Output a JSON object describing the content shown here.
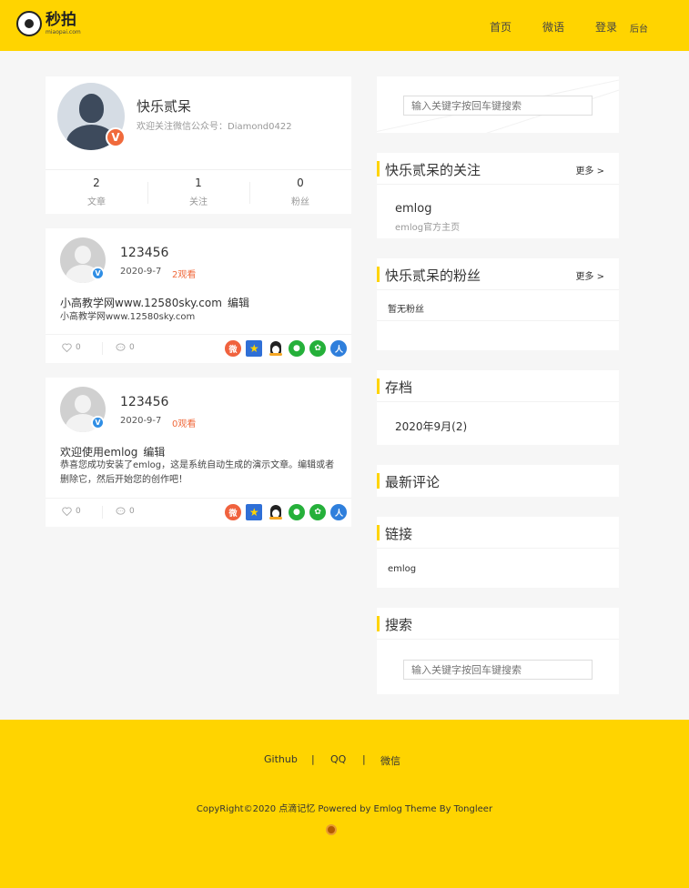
{
  "header": {
    "logo_cn": "秒拍",
    "logo_en": "miaopai.com",
    "nav": {
      "home": "首页",
      "weiyu": "微语",
      "login": "登录",
      "admin": "后台"
    },
    "color": "#ffd400"
  },
  "profile": {
    "name": "快乐贰呆",
    "desc": "欢迎关注微信公众号：Diamond0422",
    "badge": "V",
    "stats": [
      {
        "num": "2",
        "label": "文章"
      },
      {
        "num": "1",
        "label": "关注"
      },
      {
        "num": "0",
        "label": "粉丝"
      }
    ]
  },
  "posts": [
    {
      "title": "123456",
      "date": "2020-9-7",
      "views": "2观看",
      "headline": "小高教学网www.12580sky.com",
      "edit": "编辑",
      "excerpt": "小高教学网www.12580sky.com",
      "likes": "0",
      "comments": "0",
      "badge": "V"
    },
    {
      "title": "123456",
      "date": "2020-9-7",
      "views": "0观看",
      "headline": "欢迎使用emlog",
      "edit": "编辑",
      "excerpt": "恭喜您成功安装了emlog，这是系统自动生成的演示文章。编辑或者删除它，然后开始您的创作吧！",
      "likes": "0",
      "comments": "0",
      "badge": "V"
    }
  ],
  "share_icons": [
    "weibo-icon",
    "qzone-icon",
    "qq-icon",
    "wechat-icon",
    "moments-icon",
    "renren-icon"
  ],
  "sidebar": {
    "top_search": {
      "placeholder": "输入关键字按回车键搜索"
    },
    "following": {
      "title": "快乐贰呆的关注",
      "more": "更多 >",
      "items": [
        {
          "name": "emlog",
          "desc": "emlog官方主页"
        }
      ]
    },
    "fans": {
      "title": "快乐贰呆的粉丝",
      "more": "更多 >",
      "empty": "暂无粉丝"
    },
    "archive": {
      "title": "存档",
      "items": [
        "2020年9月(2)"
      ]
    },
    "comments": {
      "title": "最新评论"
    },
    "links": {
      "title": "链接",
      "items": [
        "emlog"
      ]
    },
    "search": {
      "title": "搜索",
      "placeholder": "输入关键字按回车键搜索"
    }
  },
  "footer": {
    "links": [
      "Github",
      "QQ",
      "微信"
    ],
    "separator": "|",
    "copyright": "CopyRight©2020 点滴记忆 Powered by Emlog Theme By Tongleer"
  }
}
